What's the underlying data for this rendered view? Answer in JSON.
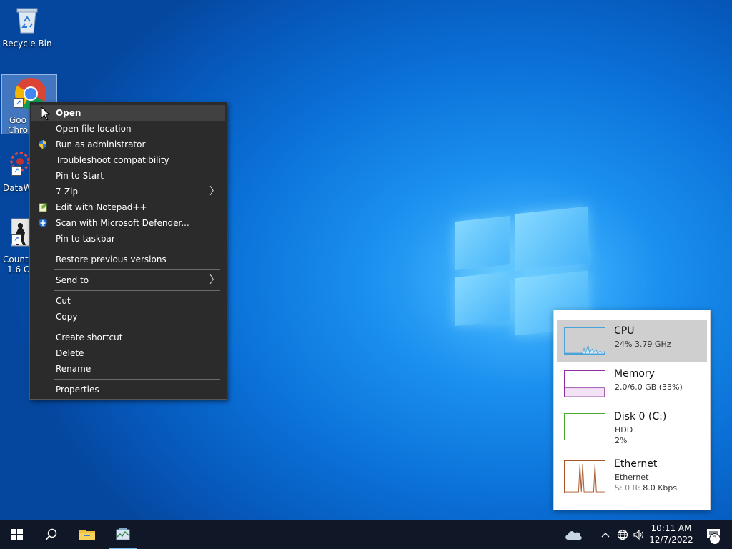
{
  "desktop": {
    "icons": [
      {
        "label": "Recycle Bin",
        "icon": "recycle-bin-icon"
      },
      {
        "label_line1": "Goo",
        "label_line2": "Chro",
        "icon": "chrome-icon"
      },
      {
        "label": "DataWa",
        "icon": "datawa-icon"
      },
      {
        "label_line1": "Counte",
        "label_line2": "1.6 Or",
        "icon": "counter-strike-icon"
      }
    ]
  },
  "context_menu": {
    "items": [
      {
        "label": "Open"
      },
      {
        "label": "Open file location"
      },
      {
        "label": "Run as administrator",
        "icon": "uac-shield-icon"
      },
      {
        "label": "Troubleshoot compatibility"
      },
      {
        "label": "Pin to Start"
      },
      {
        "label": "7-Zip"
      },
      {
        "label": "Edit with Notepad++",
        "icon": "notepad-plus-plus-icon"
      },
      {
        "label": "Scan with Microsoft Defender...",
        "icon": "defender-icon"
      },
      {
        "label": "Pin to taskbar"
      },
      {
        "label": "Restore previous versions"
      },
      {
        "label": "Send to"
      },
      {
        "label": "Cut"
      },
      {
        "label": "Copy"
      },
      {
        "label": "Create shortcut"
      },
      {
        "label": "Delete"
      },
      {
        "label": "Rename"
      },
      {
        "label": "Properties"
      }
    ]
  },
  "task_manager": {
    "cpu": {
      "name": "CPU",
      "detail": "24% 3.79 GHz",
      "color": "#4aa3d8"
    },
    "memory": {
      "name": "Memory",
      "detail": "2.0/6.0 GB (33%)",
      "color": "#8b2f9e"
    },
    "disk": {
      "name": "Disk 0 (C:)",
      "detail1": "HDD",
      "detail2": "2%",
      "color": "#4ea72e"
    },
    "ethernet": {
      "name": "Ethernet",
      "detail1": "Ethernet",
      "detail2_prefix": "S: 0 R:",
      "detail2_value": "8.0 Kbps",
      "color": "#a7562a"
    }
  },
  "taskbar": {
    "time": "10:11 AM",
    "date": "12/7/2022",
    "notification_count": "3"
  },
  "colors": {
    "taskbar_bg": "#101828",
    "menu_bg": "#2b2b2b",
    "accent": "#76b9ed"
  }
}
